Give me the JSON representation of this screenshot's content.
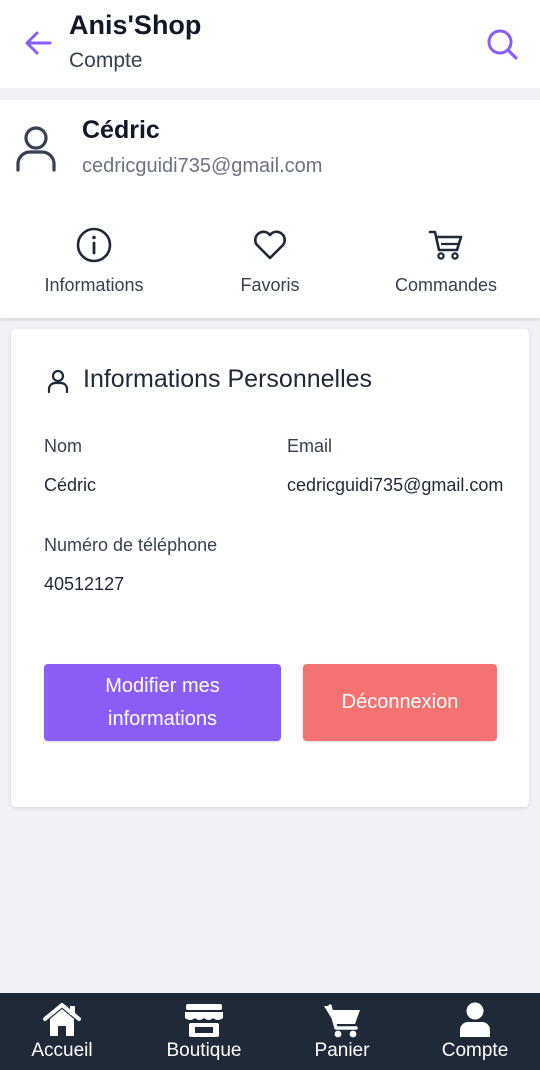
{
  "header": {
    "title": "Anis'Shop",
    "subtitle": "Compte",
    "back_icon": "arrow-left-icon",
    "search_icon": "search-icon",
    "accent_color": "#8b5cf6"
  },
  "profile": {
    "name": "Cédric",
    "email": "cedricguidi735@gmail.com",
    "avatar_icon": "user-outline-icon",
    "shortcuts": [
      {
        "label": "Informations",
        "icon": "info-circle-icon"
      },
      {
        "label": "Favoris",
        "icon": "heart-icon"
      },
      {
        "label": "Commandes",
        "icon": "cart-icon"
      }
    ]
  },
  "personal_info": {
    "title": "Informations Personnelles",
    "icon": "user-icon",
    "fields": {
      "name_label": "Nom",
      "name_value": "Cédric",
      "email_label": "Email",
      "email_value": "cedricguidi735@gmail.com",
      "phone_label": "Numéro de téléphone",
      "phone_value": "40512127"
    },
    "edit_button": {
      "label": "Modifier mes informations",
      "color": "#8b5cf6"
    },
    "logout_button": {
      "label": "Déconnexion",
      "color": "#f47272"
    }
  },
  "bottom_nav": {
    "background": "#1f2937",
    "items": [
      {
        "label": "Accueil",
        "icon": "home-icon"
      },
      {
        "label": "Boutique",
        "icon": "store-icon"
      },
      {
        "label": "Panier",
        "icon": "cart-icon"
      },
      {
        "label": "Compte",
        "icon": "user-icon"
      }
    ]
  }
}
